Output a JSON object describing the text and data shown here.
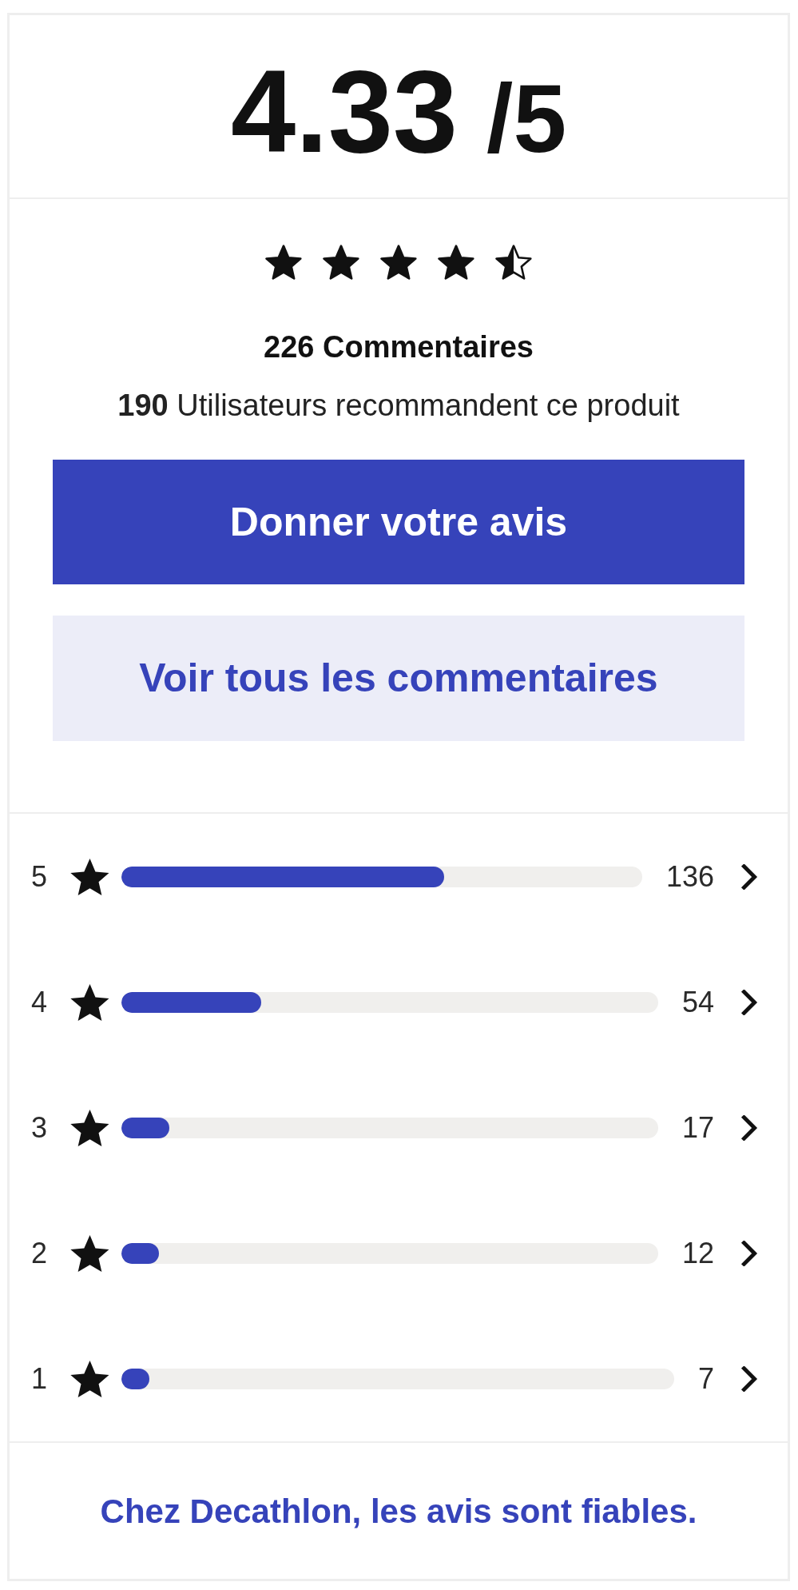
{
  "score": {
    "value": "4.33",
    "scale": "/5"
  },
  "summary": {
    "stars": 4.5,
    "comment_count": "226 Commentaires",
    "recommendations": "**190** Utilisateurs recommandent ce produit"
  },
  "buttons": [
    {
      "kind": "primary",
      "label": "Donner votre avis"
    },
    {
      "kind": "secondary",
      "label": "Voir tous les commentaires"
    }
  ],
  "distribution": [
    {
      "label": "5",
      "level": 0.62,
      "count": "136"
    },
    {
      "label": "4",
      "level": 0.26,
      "count": "54"
    },
    {
      "label": "3",
      "level": 0.09,
      "count": "17"
    },
    {
      "label": "2",
      "level": 0.07,
      "count": "12"
    },
    {
      "label": "1",
      "level": 0.05,
      "count": "7"
    }
  ],
  "footer": {
    "link": "Chez Decathlon, les avis sont fiables."
  }
}
